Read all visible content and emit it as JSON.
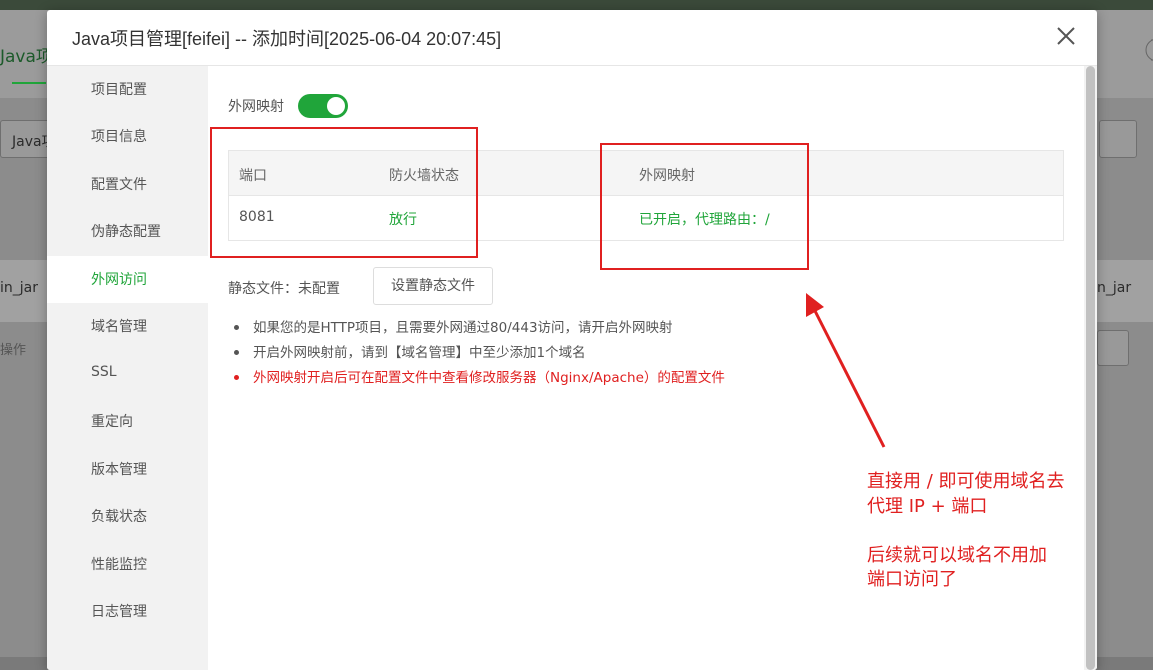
{
  "background": {
    "app_tab": "Java项",
    "select_text": "Java项",
    "row_text": "in_jar",
    "row_text_right": "n_jar",
    "ops_text": "操作"
  },
  "dialog": {
    "title": "Java项目管理[feifei] -- 添加时间[2025-06-04 20:07:45]",
    "close_icon": "close-icon"
  },
  "sidebar": {
    "items": [
      {
        "label": "项目配置"
      },
      {
        "label": "项目信息"
      },
      {
        "label": "配置文件"
      },
      {
        "label": "伪静态配置"
      },
      {
        "label": "外网访问",
        "active": true
      },
      {
        "label": "域名管理"
      },
      {
        "label": "SSL"
      },
      {
        "label": "重定向"
      },
      {
        "label": "版本管理"
      },
      {
        "label": "负载状态"
      },
      {
        "label": "性能监控"
      },
      {
        "label": "日志管理"
      }
    ]
  },
  "mapping": {
    "toggle_label": "外网映射",
    "toggle_on": true,
    "table": {
      "headers": [
        "端口",
        "防火墙状态",
        "外网映射"
      ],
      "rows": [
        [
          "8081",
          "放行",
          "已开启，代理路由：/"
        ]
      ]
    },
    "static_label": "静态文件：未配置",
    "static_button": "设置静态文件",
    "notes": [
      "如果您的是HTTP项目，且需要外网通过80/443访问，请开启外网映射",
      "开启外网映射前，请到【域名管理】中至少添加1个域名",
      "外网映射开启后可在配置文件中查看修改服务器（Nginx/Apache）的配置文件"
    ]
  },
  "annotation": {
    "line1": "直接用 / 即可使用域名去",
    "line2": "代理 IP + 端口",
    "line3": "后续就可以域名不用加",
    "line4": "端口访问了",
    "color": "#e02020"
  },
  "colors": {
    "accent": "#20a53a",
    "annotation": "#e02020"
  }
}
